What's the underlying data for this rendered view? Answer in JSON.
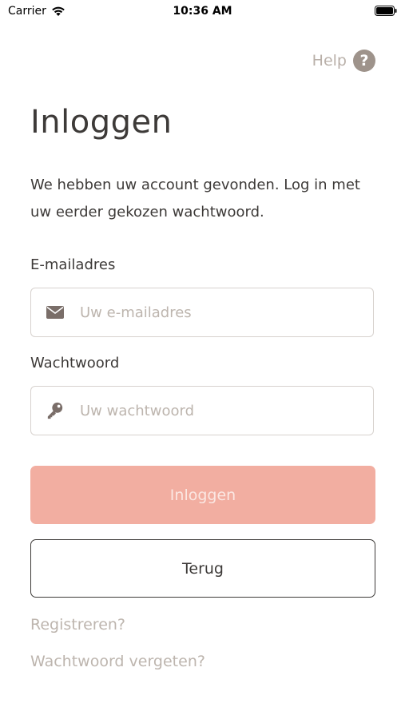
{
  "status_bar": {
    "carrier": "Carrier",
    "time": "10:36 AM"
  },
  "help": {
    "label": "Help",
    "icon_glyph": "?"
  },
  "page": {
    "title": "Inloggen",
    "intro": "We hebben uw account gevonden. Log in met uw eerder gekozen wachtwoord."
  },
  "email": {
    "label": "E-mailadres",
    "placeholder": "Uw e-mailadres",
    "value": "",
    "icon": "envelope-icon"
  },
  "password": {
    "label": "Wachtwoord",
    "placeholder": "Uw wachtwoord",
    "value": "",
    "icon": "key-icon"
  },
  "buttons": {
    "login_label": "Inloggen",
    "back_label": "Terug"
  },
  "links": {
    "register": "Registreren?",
    "forgot_password": "Wachtwoord vergeten?"
  },
  "colors": {
    "primary_button": "#f2aea1",
    "text": "#3d3a38",
    "muted_text": "#bdb5ae",
    "icon": "#7a6e69"
  }
}
